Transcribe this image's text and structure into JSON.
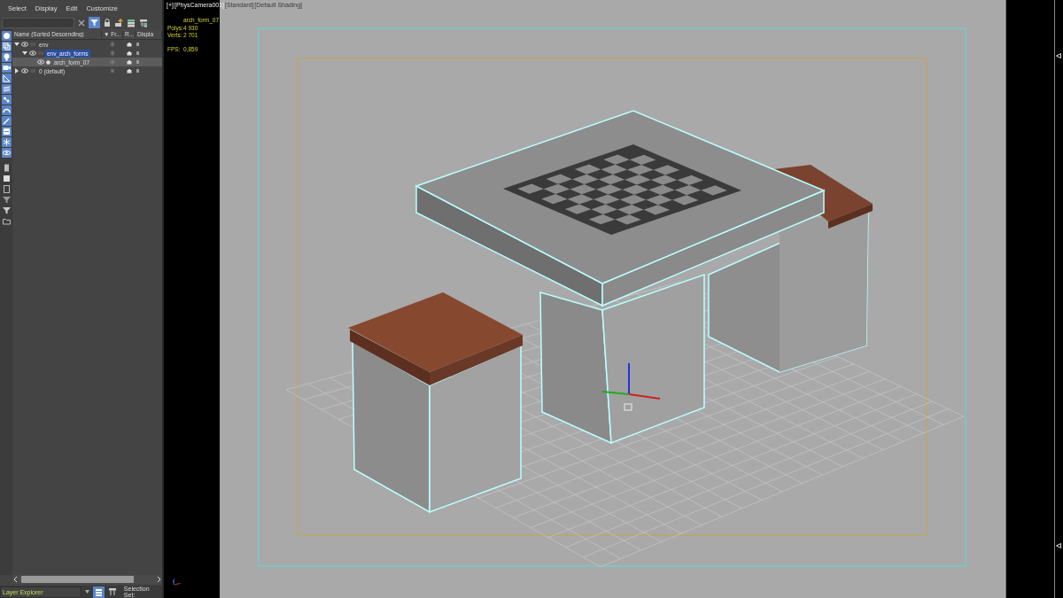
{
  "menu": [
    "Select",
    "Display",
    "Edit",
    "Customize"
  ],
  "toolbar": {
    "filter_active": true
  },
  "tree": {
    "columns": [
      "Name (Sorted Descending)",
      "▼ Fr...",
      "R...",
      "Displa"
    ],
    "rows": [
      {
        "name": "env",
        "kind": "layer",
        "expanded": true,
        "selected": false,
        "children": [
          {
            "name": "env_arch_forms",
            "kind": "layer",
            "expanded": true,
            "selected": true,
            "children": [
              {
                "name": "arch_form_07",
                "kind": "object",
                "selected": true
              }
            ]
          }
        ]
      },
      {
        "name": "0 (default)",
        "kind": "layer",
        "expanded": false,
        "selected": false
      }
    ]
  },
  "explorer": {
    "value": "Layer Explorer"
  },
  "selection_set_label": "Selection Set:",
  "viewport": {
    "labels": [
      "[+]",
      "[PhysCamera001]",
      "[Standard]",
      "[Default Shading]"
    ],
    "stats": {
      "object": "arch_form_07",
      "rows": [
        {
          "label": "Polys:",
          "value": "4 930"
        },
        {
          "label": "Verts:",
          "value": "2 701"
        },
        {
          "label": "FPS:",
          "value": "0,859"
        }
      ]
    }
  }
}
